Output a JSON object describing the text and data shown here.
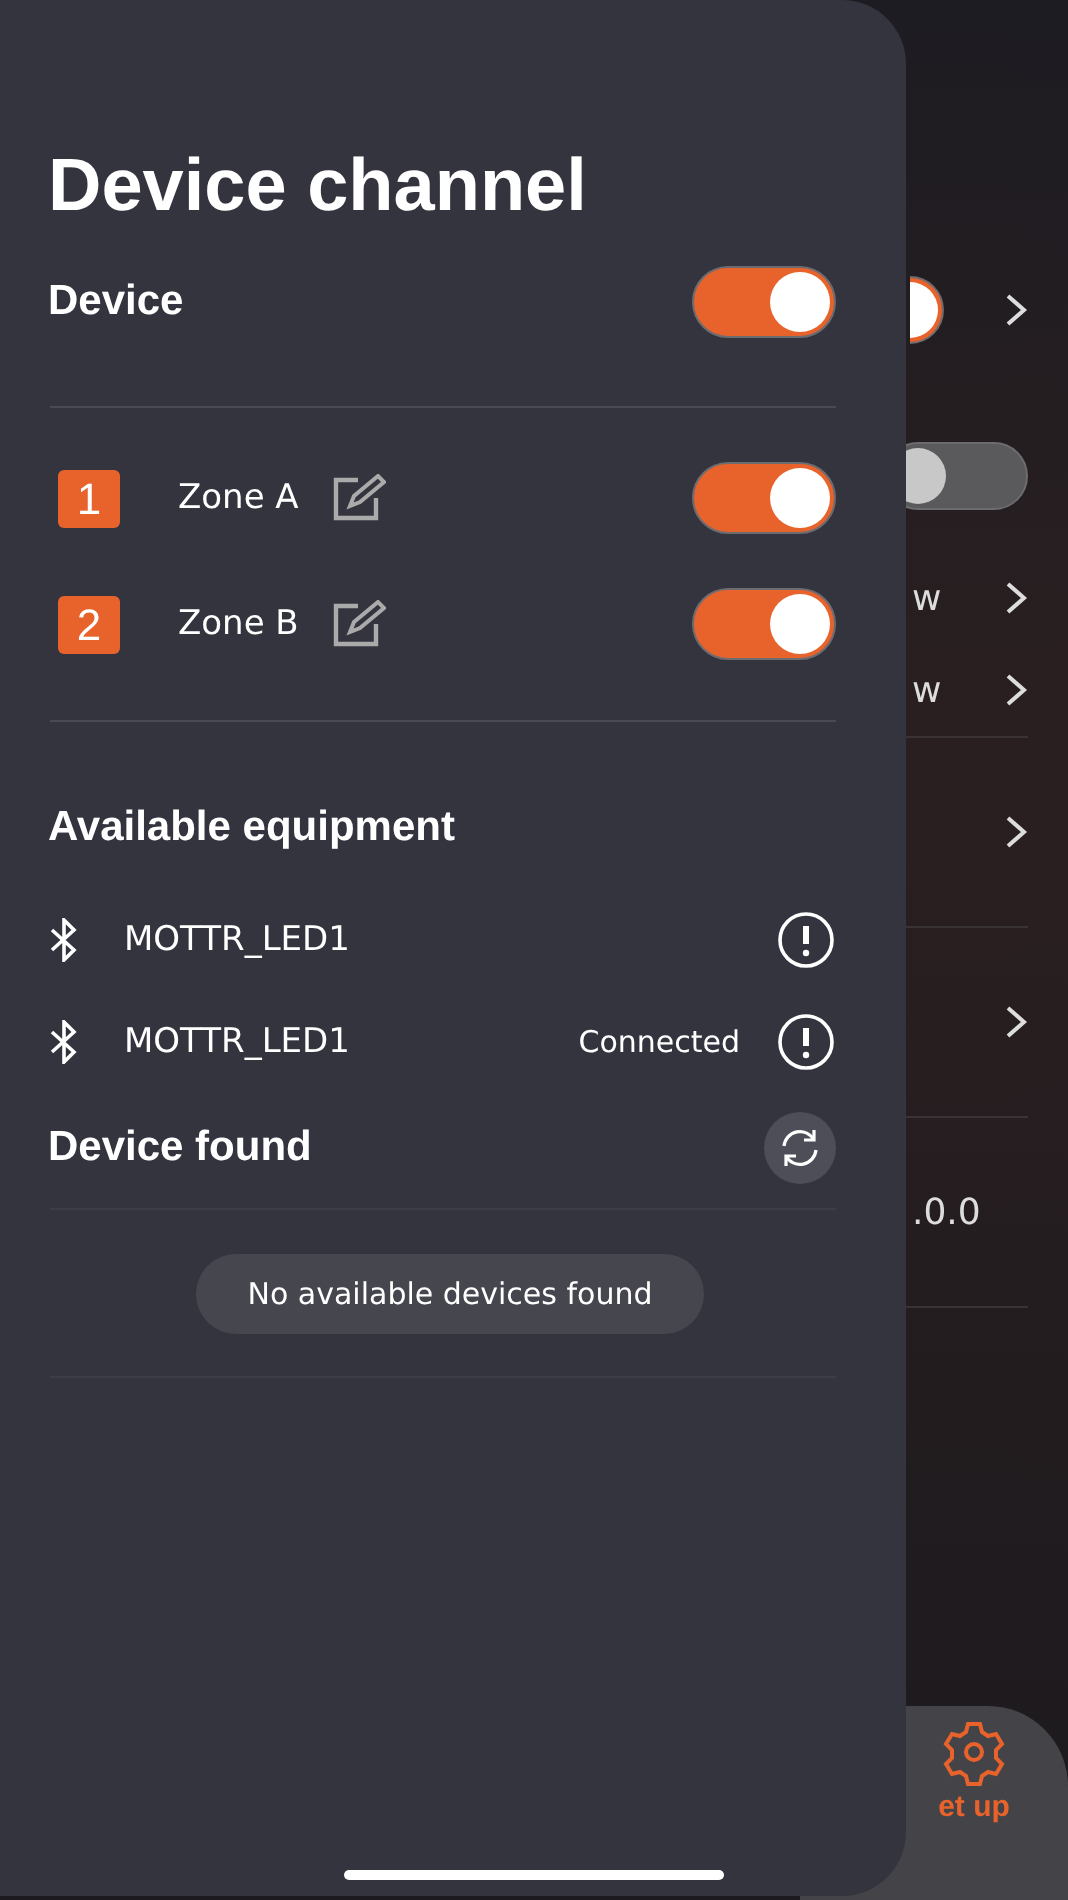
{
  "background": {
    "rows": [
      {
        "kind": "toggle",
        "on": true
      },
      {
        "kind": "toggle",
        "on": false
      },
      {
        "kind": "text",
        "value": "w"
      },
      {
        "kind": "text",
        "value": "w"
      },
      {
        "kind": "chevron"
      },
      {
        "kind": "chevron"
      },
      {
        "kind": "text",
        "value": ".0.0"
      }
    ],
    "tab": {
      "label": "et up",
      "selected": true
    }
  },
  "drawer": {
    "title": "Device channel",
    "device": {
      "label": "Device",
      "on": true
    },
    "zones": [
      {
        "number": "1",
        "name": "Zone A",
        "on": true
      },
      {
        "number": "2",
        "name": "Zone B",
        "on": true
      }
    ],
    "equipment": {
      "title": "Available equipment",
      "items": [
        {
          "name": "MOTTR_LED1"
        },
        {
          "name": "MOTTR_LED1",
          "status": "Connected"
        }
      ]
    },
    "found": {
      "title": "Device found",
      "message": "No available devices found"
    }
  }
}
